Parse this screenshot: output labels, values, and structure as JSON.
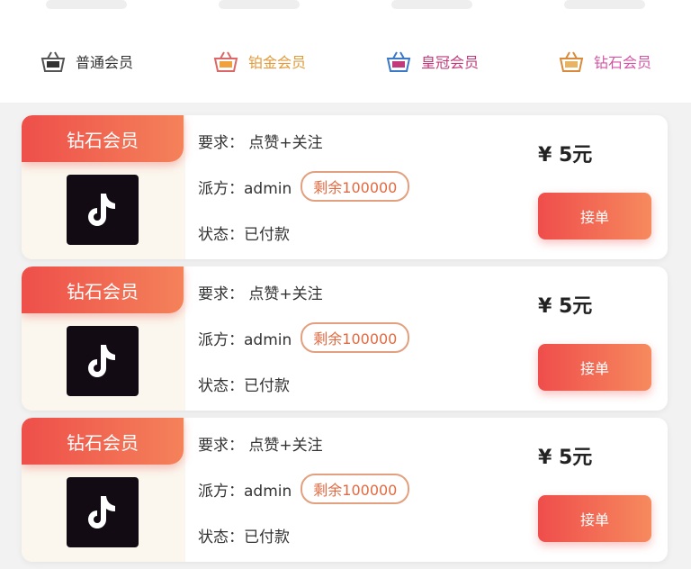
{
  "tabs": [
    {
      "label": "普通会员",
      "color": "#333333",
      "icon": "basket-icon"
    },
    {
      "label": "铂金会员",
      "color": "#e39a3b",
      "icon": "basket-icon"
    },
    {
      "label": "皇冠会员",
      "color": "#c23a7a",
      "icon": "basket-icon"
    },
    {
      "label": "钻石会员",
      "color": "#d455a4",
      "icon": "basket-icon"
    }
  ],
  "cards": [
    {
      "badge": "钻石会员",
      "require": "要求： 点赞+关注",
      "dispatcher": "派方：admin",
      "remaining": "剩余100000",
      "status": "状态：已付款",
      "price": "¥ 5元",
      "action": "接单",
      "icon": "tiktok-icon"
    },
    {
      "badge": "钻石会员",
      "require": "要求： 点赞+关注",
      "dispatcher": "派方：admin",
      "remaining": "剩余100000",
      "status": "状态：已付款",
      "price": "¥ 5元",
      "action": "接单",
      "icon": "tiktok-icon"
    },
    {
      "badge": "钻石会员",
      "require": "要求： 点赞+关注",
      "dispatcher": "派方：admin",
      "remaining": "剩余100000",
      "status": "状态：已付款",
      "price": "¥ 5元",
      "action": "接单",
      "icon": "tiktok-icon"
    }
  ],
  "colors": {
    "accent_start": "#ee4f4a",
    "accent_end": "#f4825a",
    "pill_border": "#e3a07f"
  }
}
